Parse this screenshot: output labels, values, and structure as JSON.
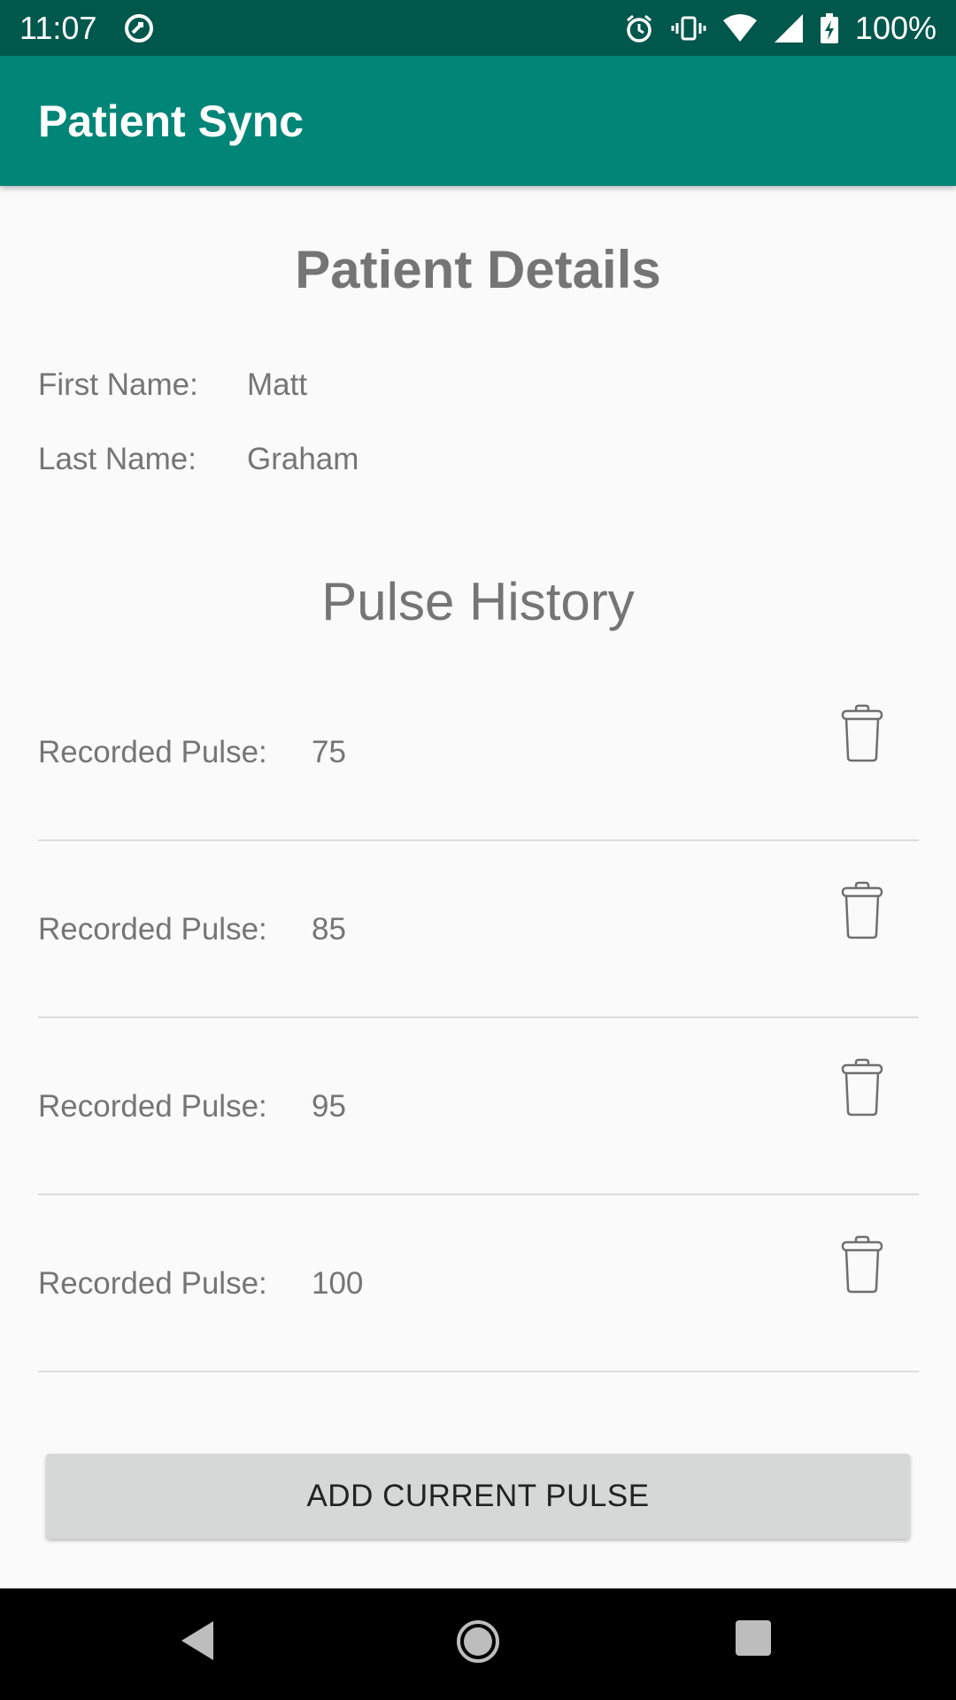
{
  "status_bar": {
    "time": "11:07",
    "battery": "100%",
    "icons": [
      "data-saver-icon",
      "alarm-icon",
      "vibrate-icon",
      "wifi-icon",
      "cell-signal-icon",
      "battery-charging-icon"
    ]
  },
  "app_bar": {
    "title": "Patient Sync"
  },
  "patient_details": {
    "title": "Patient Details",
    "first_name_label": "First Name:",
    "first_name_value": "Matt",
    "last_name_label": "Last Name:",
    "last_name_value": "Graham"
  },
  "pulse_history": {
    "title": "Pulse History",
    "items": [
      {
        "label": "Recorded Pulse:",
        "value": "75",
        "icon": "trash-icon"
      },
      {
        "label": "Recorded Pulse:",
        "value": "85",
        "icon": "trash-icon"
      },
      {
        "label": "Recorded Pulse:",
        "value": "95",
        "icon": "trash-icon"
      },
      {
        "label": "Recorded Pulse:",
        "value": "100",
        "icon": "trash-icon"
      }
    ]
  },
  "actions": {
    "add_pulse_label": "ADD CURRENT PULSE"
  },
  "nav_bar": {
    "icons": [
      "back-icon",
      "home-icon",
      "recents-icon"
    ]
  },
  "colors": {
    "status_bar": "#00574b",
    "app_bar": "#008577",
    "text_secondary": "#757575",
    "button_bg": "#d6d7d7",
    "background": "#fafafa"
  }
}
